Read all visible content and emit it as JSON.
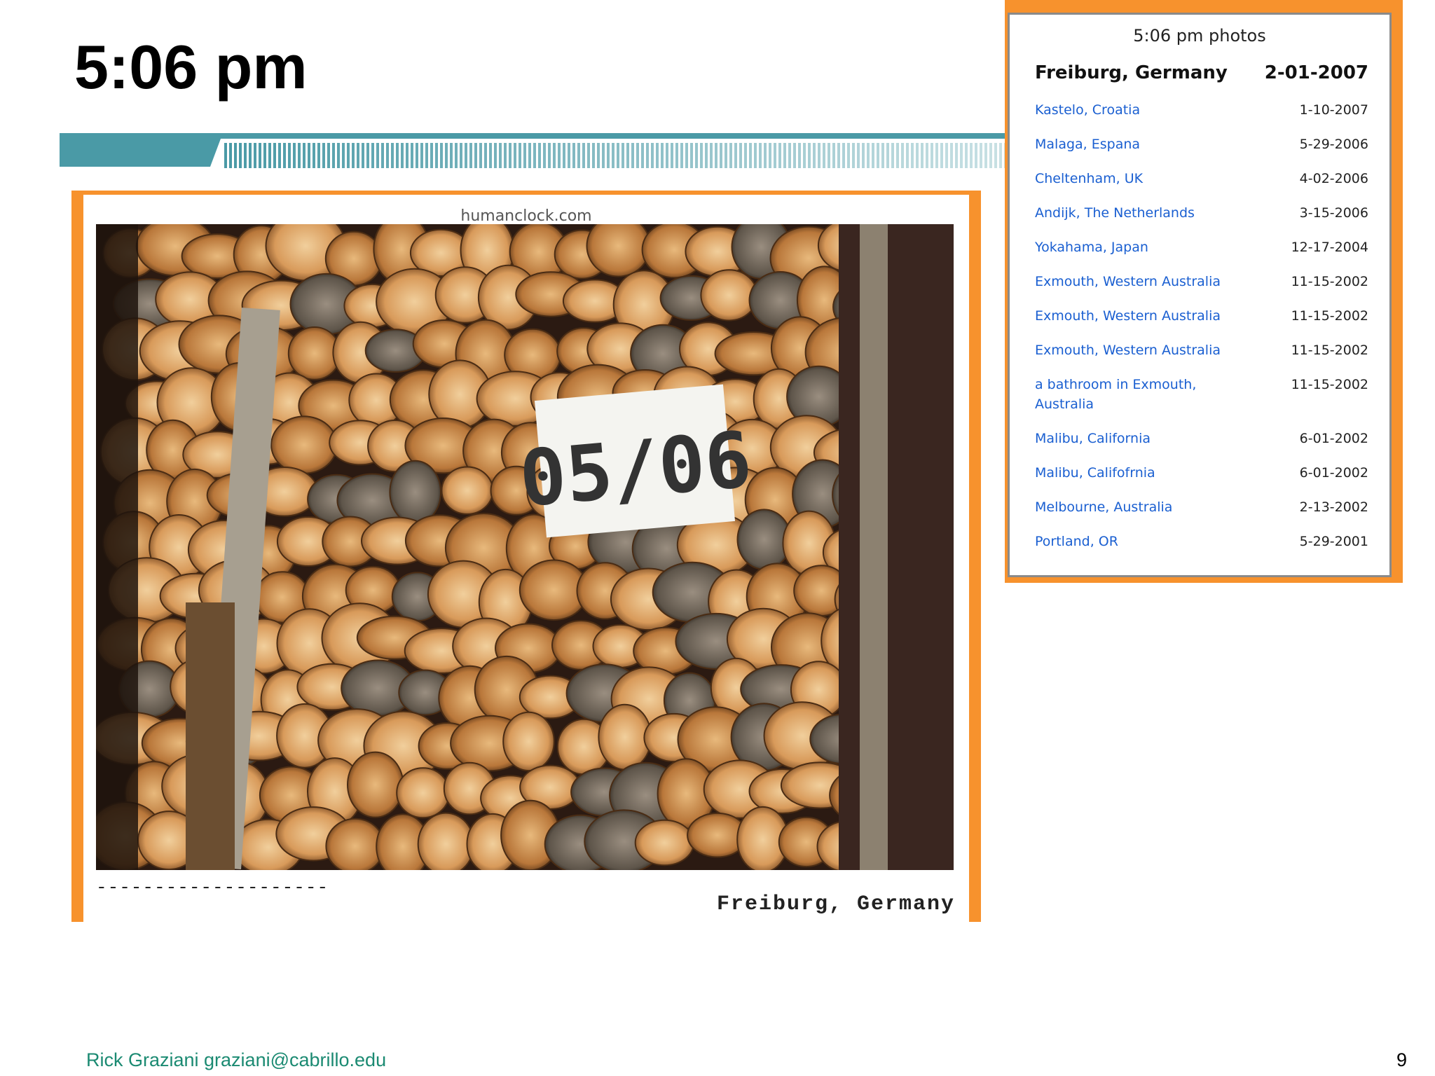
{
  "slide": {
    "title": "5:06 pm",
    "footer": "Rick Graziani  graziani@cabrillo.edu",
    "page_number": "9",
    "accent_color": "#f7922d",
    "stripe_color": "#4a9aa6"
  },
  "photo": {
    "site": "humanclock.com",
    "dashes": "--------------------",
    "sign_text": "05/06",
    "caption": "Freiburg, Germany",
    "icon": "firewood-photo"
  },
  "photo_list": {
    "heading": "5:06 pm photos",
    "current_place": "Freiburg, Germany",
    "current_date": "2-01-2007",
    "items": [
      {
        "place": "Kastelo, Croatia",
        "date": "1-10-2007"
      },
      {
        "place": "Malaga, Espana",
        "date": "5-29-2006"
      },
      {
        "place": "Cheltenham, UK",
        "date": "4-02-2006"
      },
      {
        "place": "Andijk, The Netherlands",
        "date": "3-15-2006"
      },
      {
        "place": "Yokahama, Japan",
        "date": "12-17-2004"
      },
      {
        "place": "Exmouth, Western Australia",
        "date": "11-15-2002"
      },
      {
        "place": "Exmouth, Western Australia",
        "date": "11-15-2002"
      },
      {
        "place": "Exmouth, Western Australia",
        "date": "11-15-2002"
      },
      {
        "place": "a bathroom in Exmouth, Australia",
        "date": "11-15-2002"
      },
      {
        "place": "Malibu, California",
        "date": "6-01-2002"
      },
      {
        "place": "Malibu, Califofrnia",
        "date": "6-01-2002"
      },
      {
        "place": "Melbourne, Australia",
        "date": "2-13-2002"
      },
      {
        "place": "Portland, OR",
        "date": "5-29-2001"
      }
    ]
  }
}
